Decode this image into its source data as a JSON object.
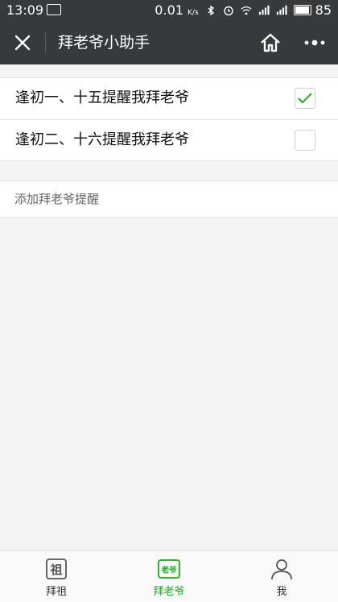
{
  "status_bar": {
    "time": "13:09",
    "speed": "0.01",
    "speed_unit": "K/s",
    "battery": "85"
  },
  "nav": {
    "title": "拜老爷小助手"
  },
  "reminders": [
    {
      "label": "逢初一、十五提醒我拜老爷",
      "checked": true
    },
    {
      "label": "逢初二、十六提醒我拜老爷",
      "checked": false
    }
  ],
  "add_reminder": {
    "label": "添加拜老爷提醒"
  },
  "tabs": [
    {
      "label": "拜祖",
      "icon_char": "祖",
      "icon": "ancestor-icon",
      "active": false
    },
    {
      "label": "拜老爷",
      "icon_char": "老爷",
      "icon": "laoye-icon",
      "active": true
    },
    {
      "label": "我",
      "icon": "person-icon",
      "active": false
    }
  ],
  "colors": {
    "nav_bg": "#38393b",
    "accent": "#1aad19",
    "page_bg": "#f4f4f4"
  }
}
